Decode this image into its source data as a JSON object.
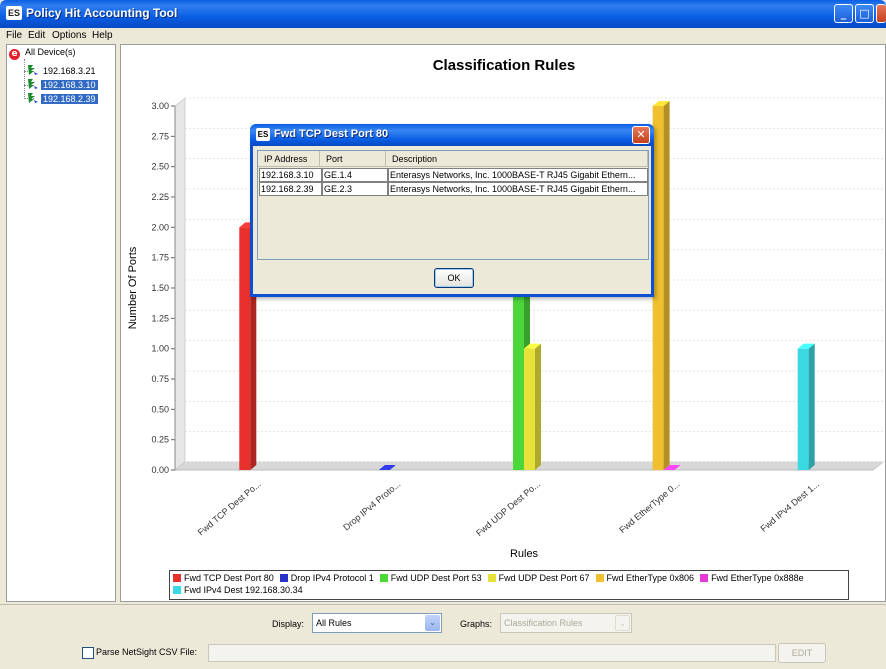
{
  "window": {
    "title": "Policy Hit Accounting Tool",
    "icon_text": "ES",
    "controls": {
      "minimize": "_",
      "maximize": "□",
      "close": "✕"
    }
  },
  "menu": {
    "items": [
      "File",
      "Edit",
      "Options",
      "Help"
    ]
  },
  "tree": {
    "root": "All Device(s)",
    "devices": [
      {
        "label": "192.168.3.21",
        "selected": false
      },
      {
        "label": "192.168.3.10",
        "selected": true
      },
      {
        "label": "192.168.2.39",
        "selected": true
      }
    ]
  },
  "chart_data": {
    "type": "bar",
    "title": "Classification Rules",
    "xlabel": "Rules",
    "ylabel": "Number Of Ports",
    "ylim": [
      0,
      3
    ],
    "yticks": [
      "0.00",
      "0.25",
      "0.50",
      "0.75",
      "1.00",
      "1.25",
      "1.50",
      "1.75",
      "2.00",
      "2.25",
      "2.50",
      "2.75",
      "3.00"
    ],
    "categories": [
      "Fwd TCP Dest Po...",
      "Drop IPv4 Proto...",
      "Fwd UDP Dest Po...",
      "Fwd EtherType 0...",
      "Fwd IPv4 Dest 1..."
    ],
    "series": [
      {
        "name": "Fwd TCP Dest Port 80",
        "color": "#e8302c",
        "category": 0,
        "value": 2
      },
      {
        "name": "Drop IPv4 Protocol 1",
        "color": "#2a31c9",
        "category": 1,
        "value": 0
      },
      {
        "name": "Fwd UDP Dest Port 53",
        "color": "#4bd63a",
        "category": 2,
        "value": 2
      },
      {
        "name": "Fwd UDP Dest Port 67",
        "color": "#e6e23a",
        "category": 2,
        "value": 1
      },
      {
        "name": "Fwd EtherType 0x806",
        "color": "#f0c030",
        "category": 3,
        "value": 3
      },
      {
        "name": "Fwd EtherType 0x888e",
        "color": "#e53ad8",
        "category": 3,
        "value": 0
      },
      {
        "name": "Fwd IPv4 Dest 192.168.30.34",
        "color": "#3ad8e0",
        "category": 4,
        "value": 1
      }
    ],
    "legend_position": "bottom",
    "grid": true
  },
  "dialog": {
    "title": "Fwd TCP Dest Port 80",
    "icon_text": "ES",
    "close": "✕",
    "columns": [
      "IP Address",
      "Port",
      "Description"
    ],
    "rows": [
      [
        "192.168.3.10",
        "GE.1.4",
        "Enterasys Networks, Inc. 1000BASE-T RJ45 Gigabit Ethern..."
      ],
      [
        "192.168.2.39",
        "GE.2.3",
        "Enterasys Networks, Inc. 1000BASE-T RJ45 Gigabit Ethern..."
      ]
    ],
    "ok_label": "OK"
  },
  "controls": {
    "display_label": "Display:",
    "display_value": "All Rules",
    "graphs_label": "Graphs:",
    "graphs_value": "Classification Rules",
    "parse_label": "Parse NetSight CSV File:",
    "parse_checked": false,
    "edit_label": "EDIT",
    "dropdown_glyph": "⌄"
  }
}
